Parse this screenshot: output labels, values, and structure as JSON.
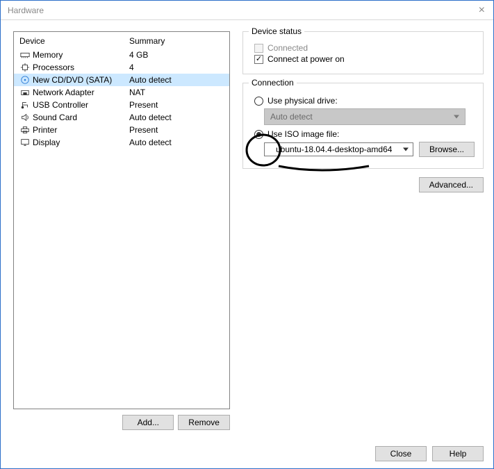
{
  "window": {
    "title": "Hardware"
  },
  "deviceTable": {
    "headers": {
      "device": "Device",
      "summary": "Summary"
    },
    "rows": [
      {
        "icon": "memory",
        "label": "Memory",
        "summary": "4 GB",
        "selected": false
      },
      {
        "icon": "cpu",
        "label": "Processors",
        "summary": "4",
        "selected": false
      },
      {
        "icon": "disc",
        "label": "New CD/DVD (SATA)",
        "summary": "Auto detect",
        "selected": true
      },
      {
        "icon": "nic",
        "label": "Network Adapter",
        "summary": "NAT",
        "selected": false
      },
      {
        "icon": "usb",
        "label": "USB Controller",
        "summary": "Present",
        "selected": false
      },
      {
        "icon": "sound",
        "label": "Sound Card",
        "summary": "Auto detect",
        "selected": false
      },
      {
        "icon": "printer",
        "label": "Printer",
        "summary": "Present",
        "selected": false
      },
      {
        "icon": "display",
        "label": "Display",
        "summary": "Auto detect",
        "selected": false
      }
    ]
  },
  "leftButtons": {
    "add": "Add...",
    "remove": "Remove"
  },
  "deviceStatus": {
    "groupTitle": "Device status",
    "connected": {
      "label": "Connected",
      "checked": false,
      "enabled": false
    },
    "powerOn": {
      "label": "Connect at power on",
      "checked": true,
      "enabled": true
    }
  },
  "connection": {
    "groupTitle": "Connection",
    "physical": {
      "label": "Use physical drive:",
      "selected": false
    },
    "physicalDrive": "Auto detect",
    "iso": {
      "label": "Use ISO image file:",
      "selected": true
    },
    "isoPath": "ubuntu-18.04.4-desktop-amd64",
    "browse": "Browse..."
  },
  "advanced": "Advanced...",
  "footer": {
    "close": "Close",
    "help": "Help"
  }
}
